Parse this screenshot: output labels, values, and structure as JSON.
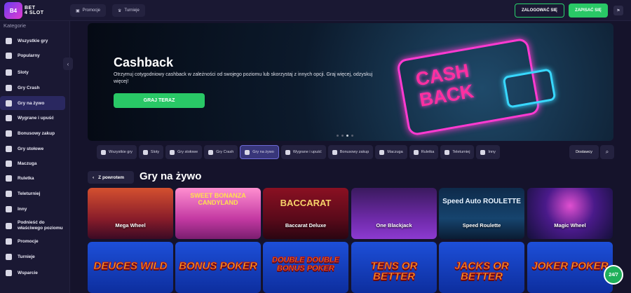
{
  "brand": {
    "badge": "B4",
    "line1": "BET",
    "line2": "4 SLOT"
  },
  "topbar": {
    "promotions_label": "Promocje",
    "tournaments_label": "Turnieje",
    "login_label": "ZALOGOWAĆ SIĘ",
    "register_label": "ZAPISAĆ SIĘ",
    "lang_icon": "flag-icon"
  },
  "sidebar": {
    "title": "Kategorie",
    "items": [
      {
        "label": "Wszystkie gry",
        "icon": "grid-icon"
      },
      {
        "label": "Popularny",
        "icon": "fire-icon"
      },
      {
        "label": "Sloty",
        "icon": "slot-icon"
      },
      {
        "label": "Gry Crash",
        "icon": "rocket-icon"
      },
      {
        "label": "Gry na żywo",
        "icon": "live-icon"
      },
      {
        "label": "Wygrane i upuść",
        "icon": "trophy-icon"
      },
      {
        "label": "Bonusowy zakup",
        "icon": "gift-icon"
      },
      {
        "label": "Gry stołowe",
        "icon": "dice-icon"
      },
      {
        "label": "Maczuga",
        "icon": "chip-icon"
      },
      {
        "label": "Ruletka",
        "icon": "roulette-icon"
      },
      {
        "label": "Teleturniej",
        "icon": "tv-icon"
      },
      {
        "label": "Inny",
        "icon": "more-icon"
      },
      {
        "label": "Podnieść do właściwego poziomu",
        "icon": "level-icon"
      },
      {
        "label": "Promocje",
        "icon": "percent-icon"
      },
      {
        "label": "Turnieje",
        "icon": "cup-icon"
      },
      {
        "label": "Wsparcie",
        "icon": "headset-icon"
      }
    ]
  },
  "hero": {
    "title": "Cashback",
    "description": "Otrzymuj cotygodniowy cashback w zależności od swojego poziomu lub skorzystaj z innych opcji. Graj więcej, odzyskuj więcej!",
    "cta": "GRAJ TERAZ",
    "neon_line1": "CASH",
    "neon_line2": "BACK"
  },
  "categories": [
    {
      "label": "Wszystkie gry"
    },
    {
      "label": "Sloty"
    },
    {
      "label": "Gry stołowe"
    },
    {
      "label": "Gry Crash"
    },
    {
      "label": "Gry na żywo"
    },
    {
      "label": "Wygrane i upuść"
    },
    {
      "label": "Bonusowy zakup"
    },
    {
      "label": "Maczuga"
    },
    {
      "label": "Ruletka"
    },
    {
      "label": "Teleturniej"
    },
    {
      "label": "Inny"
    }
  ],
  "provider_label": "Dostawcy",
  "section": {
    "back_label": "Z powrotem",
    "title": "Gry na żywo"
  },
  "games_row1": [
    {
      "label": "Mega Wheel",
      "art": ""
    },
    {
      "label": "SWEET BONANZA CANDYLAND",
      "art": "SWEET BONANZA CANDYLAND"
    },
    {
      "label": "Baccarat Deluxe",
      "art": "BACCARAT"
    },
    {
      "label": "One Blackjack",
      "art": ""
    },
    {
      "label": "Speed Roulette",
      "art": "Speed Auto ROULETTE"
    },
    {
      "label": "Magic Wheel",
      "art": ""
    }
  ],
  "games_row2": [
    {
      "label": "DEUCES WILD"
    },
    {
      "label": "BONUS POKER"
    },
    {
      "label": "DOUBLE DOUBLE BONUS POKER"
    },
    {
      "label": "TENS OR BETTER"
    },
    {
      "label": "JACKS OR BETTER"
    },
    {
      "label": "JOKER POKER"
    }
  ],
  "chat_label": "24/7"
}
